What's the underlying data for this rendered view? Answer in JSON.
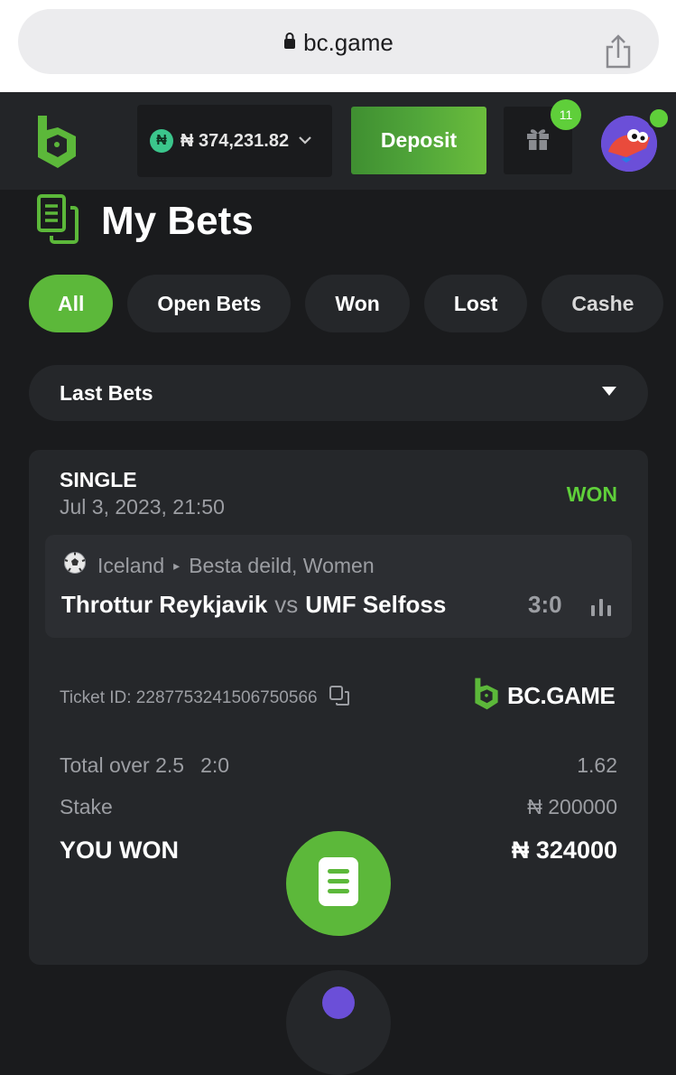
{
  "browser": {
    "url": "bc.game"
  },
  "nav": {
    "balance": "₦ 374,231.82",
    "currency_symbol": "₦",
    "deposit_label": "Deposit",
    "gift_badge_count": "11"
  },
  "page": {
    "title": "My Bets"
  },
  "filters": [
    "All",
    "Open Bets",
    "Won",
    "Lost",
    "Cashe"
  ],
  "active_filter": "All",
  "dropdown": {
    "selected": "Last Bets"
  },
  "bet": {
    "type": "SINGLE",
    "datetime": "Jul 3, 2023, 21:50",
    "status": "WON",
    "country": "Iceland",
    "league": "Besta deild, Women",
    "home_team": "Throttur Reykjavik",
    "vs": "vs",
    "away_team": "UMF Selfoss",
    "score": "3:0",
    "ticket_id": "Ticket ID: 228775324150675056​6",
    "brand": "BC.GAME",
    "market": "Total over 2.5",
    "market_score": "2:0",
    "odds": "1.62",
    "stake_label": "Stake",
    "stake_value": "₦ 200000",
    "won_label": "YOU WON",
    "won_value": "₦ 324000"
  },
  "colors": {
    "accent_green": "#5cb83a",
    "won_green": "#5fcf3a",
    "background": "#1a1b1d",
    "card": "#25272a"
  }
}
